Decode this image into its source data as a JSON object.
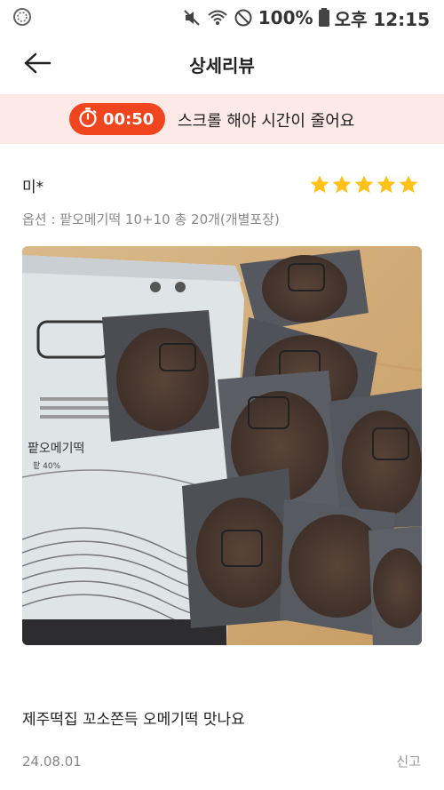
{
  "status_bar": {
    "battery": "100%",
    "time": "오후 12:15",
    "icons": [
      "ring-indicator-icon",
      "mute-icon",
      "wifi-icon",
      "do-not-disturb-icon",
      "battery-icon"
    ]
  },
  "header": {
    "title": "상세리뷰",
    "back_icon": "arrow-left-icon"
  },
  "timer_banner": {
    "time": "00:50",
    "message": "스크롤 해야 시간이 줄어요",
    "icon": "stopwatch-icon",
    "accent_color": "#f0451f",
    "background_color": "#fdeae6"
  },
  "review": {
    "reviewer": "미*",
    "rating": 5,
    "rating_max": 5,
    "star_color": "#ffc21a",
    "option": "옵션 : 팥오메기떡 10+10 총 20개(개별포장)",
    "text": "제주떡집 꼬소쫀득 오메기떡 맛나요",
    "date": "24.08.01",
    "report_label": "신고",
    "photo": {
      "package_label": "팥오메기떡",
      "package_sublabel": "팥 40%"
    }
  }
}
